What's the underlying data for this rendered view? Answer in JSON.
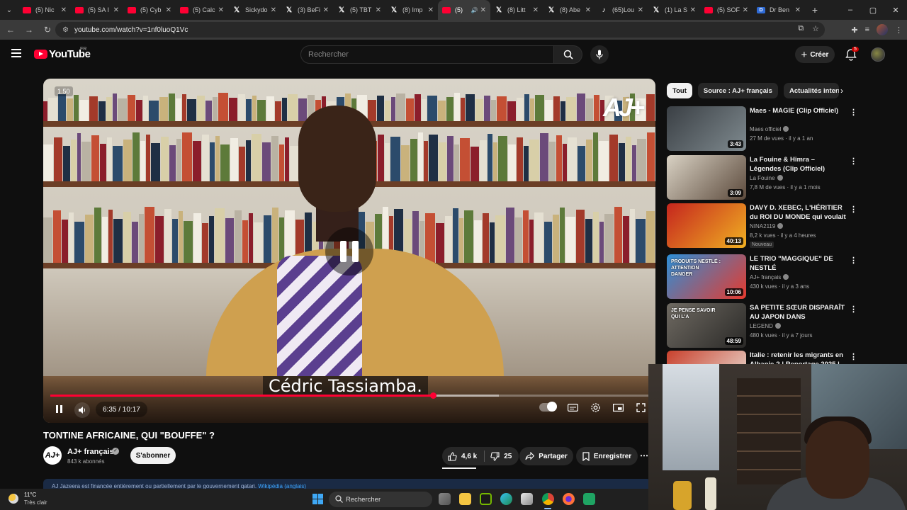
{
  "browser": {
    "tabs": [
      {
        "label": "(5) Nic",
        "favicon": "youtube-icon"
      },
      {
        "label": "(5) SA I",
        "favicon": "youtube-icon"
      },
      {
        "label": "(5) Cyb",
        "favicon": "youtube-icon"
      },
      {
        "label": "(5) Calc",
        "favicon": "youtube-icon"
      },
      {
        "label": "Sickydo",
        "favicon": "x-icon"
      },
      {
        "label": "(3) BeFi",
        "favicon": "x-icon"
      },
      {
        "label": "(5) TBT",
        "favicon": "x-icon"
      },
      {
        "label": "(8) Imp",
        "favicon": "x-icon"
      },
      {
        "label": "(5)",
        "favicon": "youtube-icon",
        "active": true
      },
      {
        "label": "(8) Litt",
        "favicon": "x-icon"
      },
      {
        "label": "(8) Abe",
        "favicon": "x-icon"
      },
      {
        "label": "(65)Lou",
        "favicon": "tiktok-icon"
      },
      {
        "label": "(1) La S",
        "favicon": "x-icon"
      },
      {
        "label": "(5) SOF",
        "favicon": "youtube-icon"
      },
      {
        "label": "Dr Ben",
        "favicon": "db-icon"
      }
    ],
    "url": "youtube.com/watch?v=1nf0luoQ1Vc"
  },
  "masthead": {
    "logo_text": "YouTube",
    "country": "FR",
    "search_placeholder": "Rechercher",
    "create_label": "Créer",
    "notification_count": "5"
  },
  "player": {
    "speed_label": "1.50",
    "watermark": "AJ+",
    "caption": "Cédric Tassiamba.",
    "time": "6:35 / 10:17",
    "progress": 0.64,
    "buffered": 0.75
  },
  "video": {
    "title": "TONTINE AFRICAINE, QUI \"BOUFFE\" ?",
    "channel": "AJ+ français",
    "channel_avatar_text": "AJ+",
    "subscribers": "843 k abonnés",
    "subscribe_label": "S'abonner",
    "likes": "4,6 k",
    "dislikes": "25",
    "share_label": "Partager",
    "save_label": "Enregistrer",
    "info_text": "AJ Jazeera est financée entièrement ou partiellement par le gouvernement qatari.",
    "info_link": "Wikipédia (anglais)"
  },
  "sidebar": {
    "chips": [
      "Tout",
      "Source : AJ+ français",
      "Actualités interna"
    ],
    "recommendations": [
      {
        "title": "Maes - MAGIE (Clip Officiel)",
        "channel": "Maes officiel",
        "meta": "27 M de vues · il y a 1 an",
        "duration": "3:43",
        "thumb_colors": [
          "#3a3f44",
          "#7f8a8f"
        ]
      },
      {
        "title": "La Fouine & Himra – Légendes (Clip Officiel)",
        "channel": "La Fouine",
        "meta": "7,8 M de vues · il y a 1 mois",
        "duration": "3:09",
        "thumb_colors": [
          "#d9d2c4",
          "#5c4a3c"
        ]
      },
      {
        "title": "DAVY D. XEBEC, L'HÉRITIER du ROI DU MONDE qui voulait ...",
        "channel": "NINA2119",
        "meta": "8,2 k vues · il y a 4 heures",
        "badge": "Nouveau",
        "duration": "40:13",
        "thumb_colors": [
          "#c5251e",
          "#f0b022"
        ]
      },
      {
        "title": "LE TRIO \"MAGGIQUE\" DE NESTLÉ",
        "channel": "AJ+ français",
        "meta": "430 k vues · il y a 3 ans",
        "duration": "10:06",
        "thumb_colors": [
          "#2c8fd8",
          "#e63a2e"
        ],
        "thumb_text": "PRODUITS NESTLÉ : ATTENTION DANGER"
      },
      {
        "title": "SA PETITE SŒUR DISPARAÎT AU JAPON DANS D'HORRIBLE...",
        "channel": "LEGEND",
        "meta": "480 k vues · il y a 7 jours",
        "duration": "48:59",
        "thumb_colors": [
          "#6f6a62",
          "#2a2927"
        ],
        "thumb_text": "JE PENSE SAVOIR QUI L'A"
      },
      {
        "title": "Italie : retenir les migrants en Albanie ? | Reportage 2025 |",
        "channel": "",
        "meta": "",
        "duration": "",
        "thumb_colors": [
          "#c8402c",
          "#ebe6de"
        ]
      }
    ]
  },
  "taskbar": {
    "temp": "11°C",
    "weather": "Très clair",
    "search_label": "Rechercher",
    "apps": [
      "task-view-icon",
      "file-explorer-icon",
      "nvidia-icon",
      "edge-icon",
      "store-icon",
      "chrome-icon",
      "firefox-icon",
      "app-icon"
    ]
  },
  "colors": {
    "accent": "#ff0033",
    "background": "#0f0f0f"
  }
}
